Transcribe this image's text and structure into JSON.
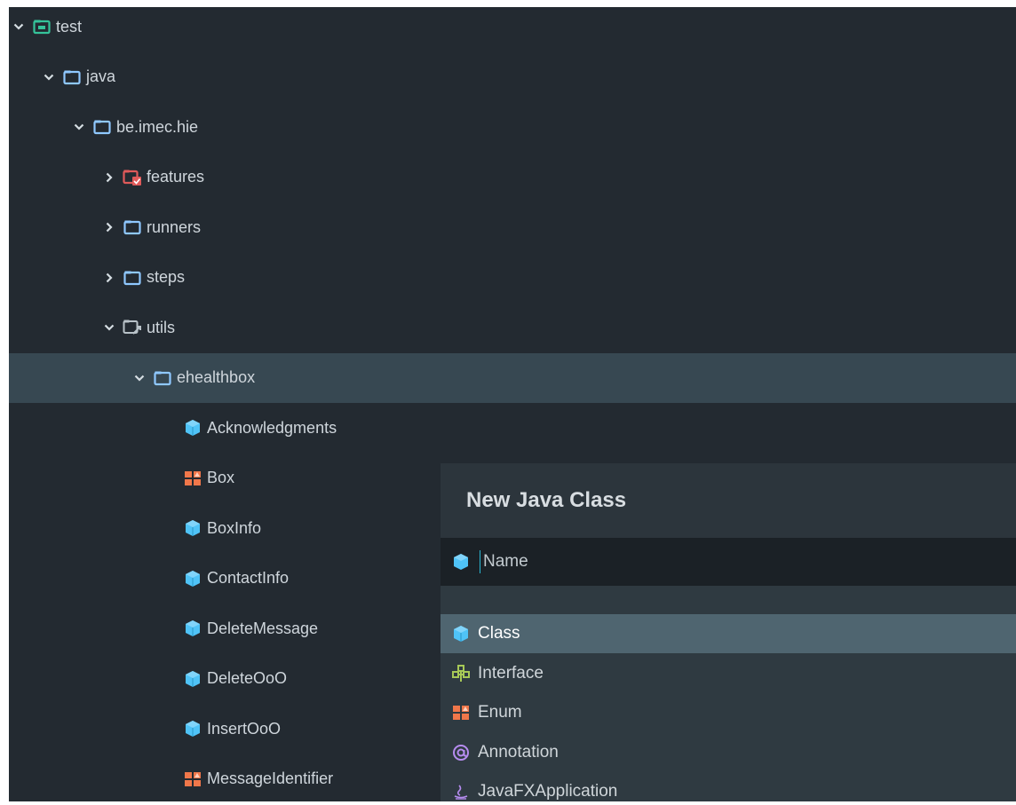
{
  "colors": {
    "panel_bg": "#232a31",
    "selected_row": "#374852",
    "popup_selected": "#4f6570",
    "text": "#cfd6dc",
    "class_icon": "#4fc3f7",
    "enum_icon": "#f0774a",
    "interface_icon": "#a7c957",
    "annotation_icon": "#b68cf0"
  },
  "tree": {
    "items": [
      {
        "label": "test",
        "expanded": true,
        "icon": "test-folder-icon"
      },
      {
        "label": "java",
        "expanded": true,
        "icon": "source-folder-icon"
      },
      {
        "label": "be.imec.hie",
        "expanded": true,
        "icon": "package-folder-icon"
      },
      {
        "label": "features",
        "expanded": false,
        "icon": "features-folder-icon"
      },
      {
        "label": "runners",
        "expanded": false,
        "icon": "package-folder-icon"
      },
      {
        "label": "steps",
        "expanded": false,
        "icon": "package-folder-icon"
      },
      {
        "label": "utils",
        "expanded": true,
        "icon": "utils-folder-icon"
      },
      {
        "label": "ehealthbox",
        "expanded": true,
        "icon": "package-folder-icon",
        "selected": true
      },
      {
        "label": "Acknowledgments",
        "icon": "class-icon"
      },
      {
        "label": "Box",
        "icon": "enum-icon"
      },
      {
        "label": "BoxInfo",
        "icon": "class-icon"
      },
      {
        "label": "ContactInfo",
        "icon": "class-icon"
      },
      {
        "label": "DeleteMessage",
        "icon": "class-icon"
      },
      {
        "label": "DeleteOoO",
        "icon": "class-icon"
      },
      {
        "label": "InsertOoO",
        "icon": "class-icon"
      },
      {
        "label": "MessageIdentifier",
        "icon": "enum-icon"
      }
    ]
  },
  "dialog": {
    "title": "New Java Class",
    "name_placeholder": "Name",
    "kinds": [
      {
        "label": "Class",
        "icon": "class-icon",
        "selected": true
      },
      {
        "label": "Interface",
        "icon": "interface-icon"
      },
      {
        "label": "Enum",
        "icon": "enum-icon"
      },
      {
        "label": "Annotation",
        "icon": "annotation-icon"
      },
      {
        "label": "JavaFXApplication",
        "icon": "javafx-icon"
      }
    ]
  }
}
